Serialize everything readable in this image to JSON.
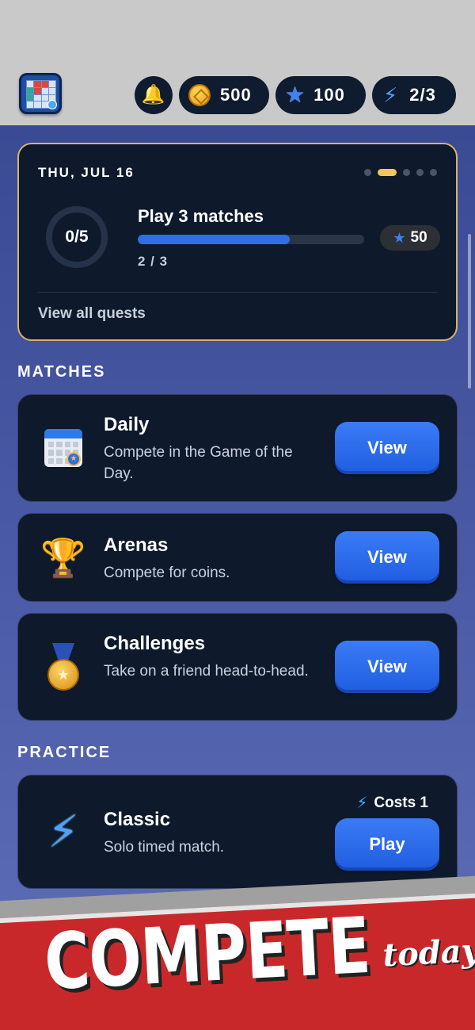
{
  "header": {
    "app_icon": "puzzle-grid-app-icon",
    "bell_icon": "bell-icon",
    "coins": "500",
    "stars": "100",
    "energy": "2/3"
  },
  "quest": {
    "date": "THU, JUL 16",
    "page_dots": 5,
    "active_dot": 1,
    "ring_label": "0/5",
    "title": "Play 3 matches",
    "progress_fraction": 0.67,
    "progress_text": "2 / 3",
    "reward": "50",
    "link": "View all quests",
    "border_color": "#d8b36a"
  },
  "matches": {
    "section_title": "MATCHES",
    "items": [
      {
        "title": "Daily",
        "desc": "Compete in the Game of the Day.",
        "button": "View",
        "icon": "calendar-star-icon"
      },
      {
        "title": "Arenas",
        "desc": "Compete for coins.",
        "button": "View",
        "icon": "trophy-icon"
      },
      {
        "title": "Challenges",
        "desc": "Take on a friend head-to-head.",
        "button": "View",
        "icon": "medal-icon"
      }
    ]
  },
  "practice": {
    "section_title": "PRACTICE",
    "items": [
      {
        "title": "Classic",
        "desc": "Solo timed match.",
        "button": "Play",
        "cost": "Costs 1",
        "icon": "lightning-icon"
      }
    ]
  },
  "banner": {
    "main": "COMPETE",
    "sub": "today!"
  },
  "colors": {
    "accent_blue": "#2f6fe6",
    "card_bg": "#0e1a2c",
    "banner_red": "#c9282b",
    "gold": "#f3c463"
  }
}
